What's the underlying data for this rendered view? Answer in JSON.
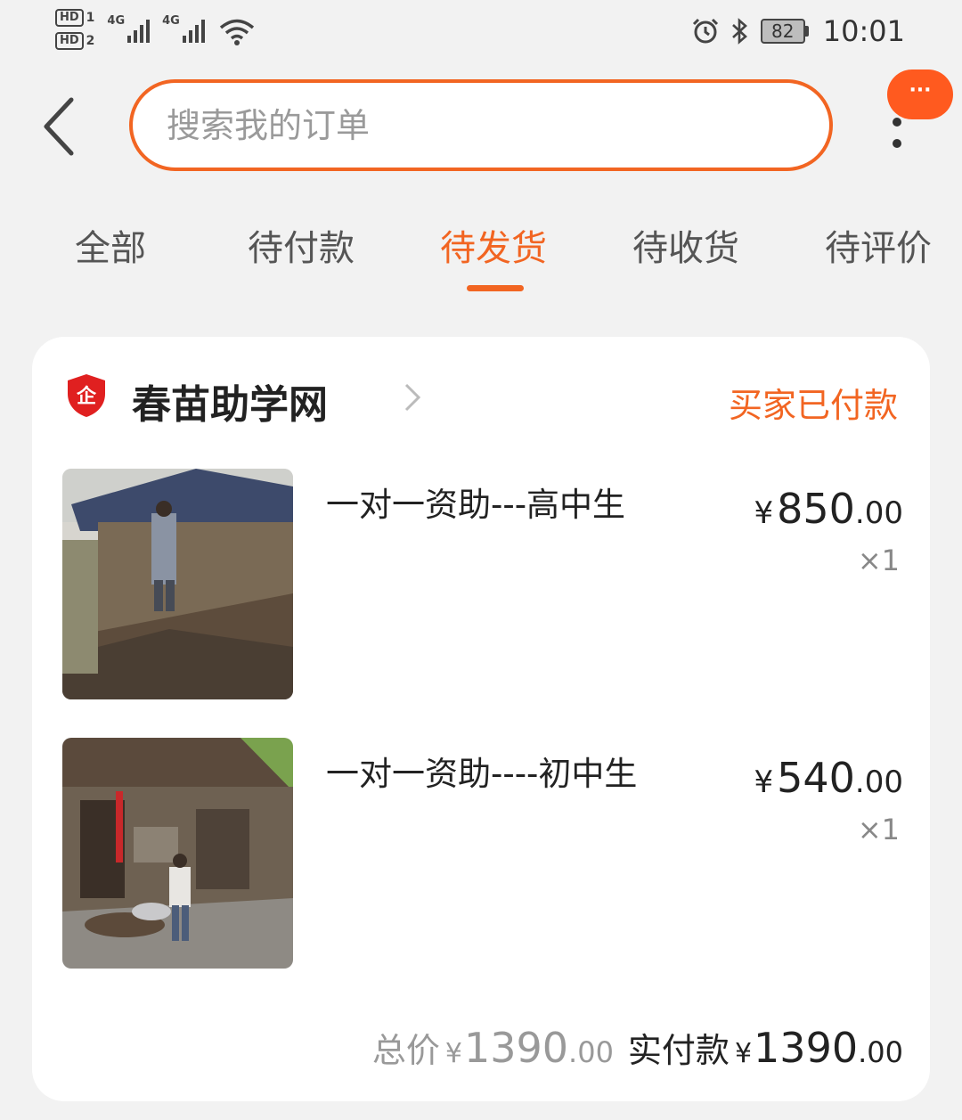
{
  "status_bar": {
    "sim1": "HD",
    "sim1_num": "1",
    "sim2": "HD",
    "sim2_num": "2",
    "network1": "4G",
    "network2": "4G",
    "battery": "82",
    "time": "10:01"
  },
  "header": {
    "search_placeholder": "搜索我的订单",
    "more_label": "···"
  },
  "tabs": [
    {
      "label": "全部",
      "active": false
    },
    {
      "label": "待付款",
      "active": false
    },
    {
      "label": "待发货",
      "active": true
    },
    {
      "label": "待收货",
      "active": false
    },
    {
      "label": "待评价",
      "active": false
    }
  ],
  "order": {
    "shop_name": "春苗助学网",
    "shop_badge": "企",
    "status": "买家已付款",
    "items": [
      {
        "title": "一对一资助---高中生",
        "currency": "¥",
        "price_int": "850",
        "price_dec": ".00",
        "qty": "×1"
      },
      {
        "title": "一对一资助----初中生",
        "currency": "¥",
        "price_int": "540",
        "price_dec": ".00",
        "qty": "×1"
      }
    ],
    "total_label": "总价",
    "total_currency": "¥",
    "total_int": "1390",
    "total_dec": ".00",
    "paid_label": "实付款",
    "paid_currency": "¥",
    "paid_int": "1390",
    "paid_dec": ".00"
  },
  "colors": {
    "accent": "#f26522",
    "badge": "#ff5a1f",
    "shop_badge_red": "#e02020"
  }
}
